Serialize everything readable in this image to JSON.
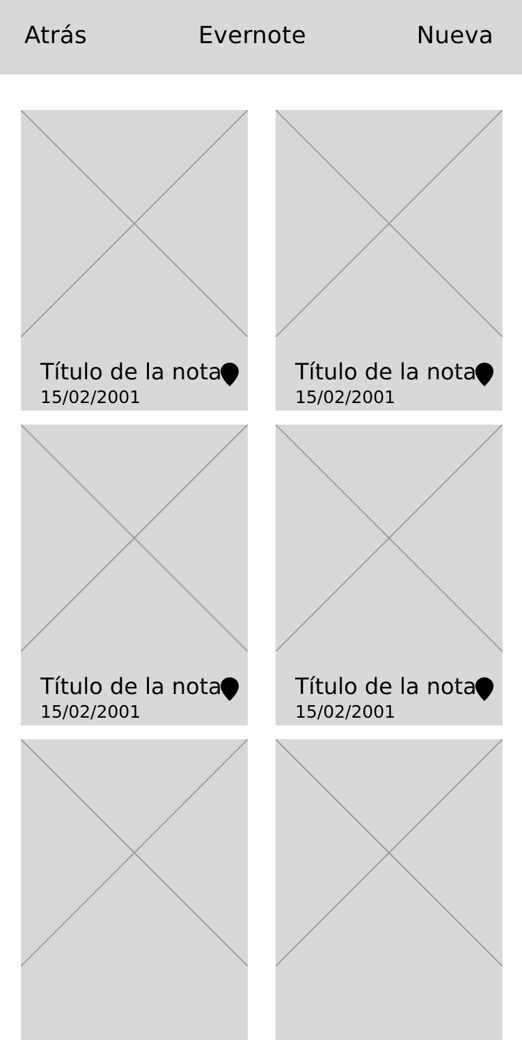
{
  "navbar": {
    "back_label": "Atrás",
    "title": "Evernote",
    "new_label": "Nueva"
  },
  "notes": [
    {
      "title": "Título de la nota",
      "date": "15/02/2001",
      "icon": "location-pin-icon"
    },
    {
      "title": "Título de la nota",
      "date": "15/02/2001",
      "icon": "location-pin-icon"
    },
    {
      "title": "Título de la nota",
      "date": "15/02/2001",
      "icon": "location-pin-icon"
    },
    {
      "title": "Título de la nota",
      "date": "15/02/2001",
      "icon": "location-pin-icon"
    },
    {
      "title": "",
      "date": "",
      "icon": ""
    },
    {
      "title": "",
      "date": "",
      "icon": ""
    }
  ],
  "colors": {
    "navbar_bg": "#d8d8d8",
    "card_bg": "#d8d8d8",
    "placeholder_lines": "#9b9b9b",
    "text": "#000000"
  }
}
